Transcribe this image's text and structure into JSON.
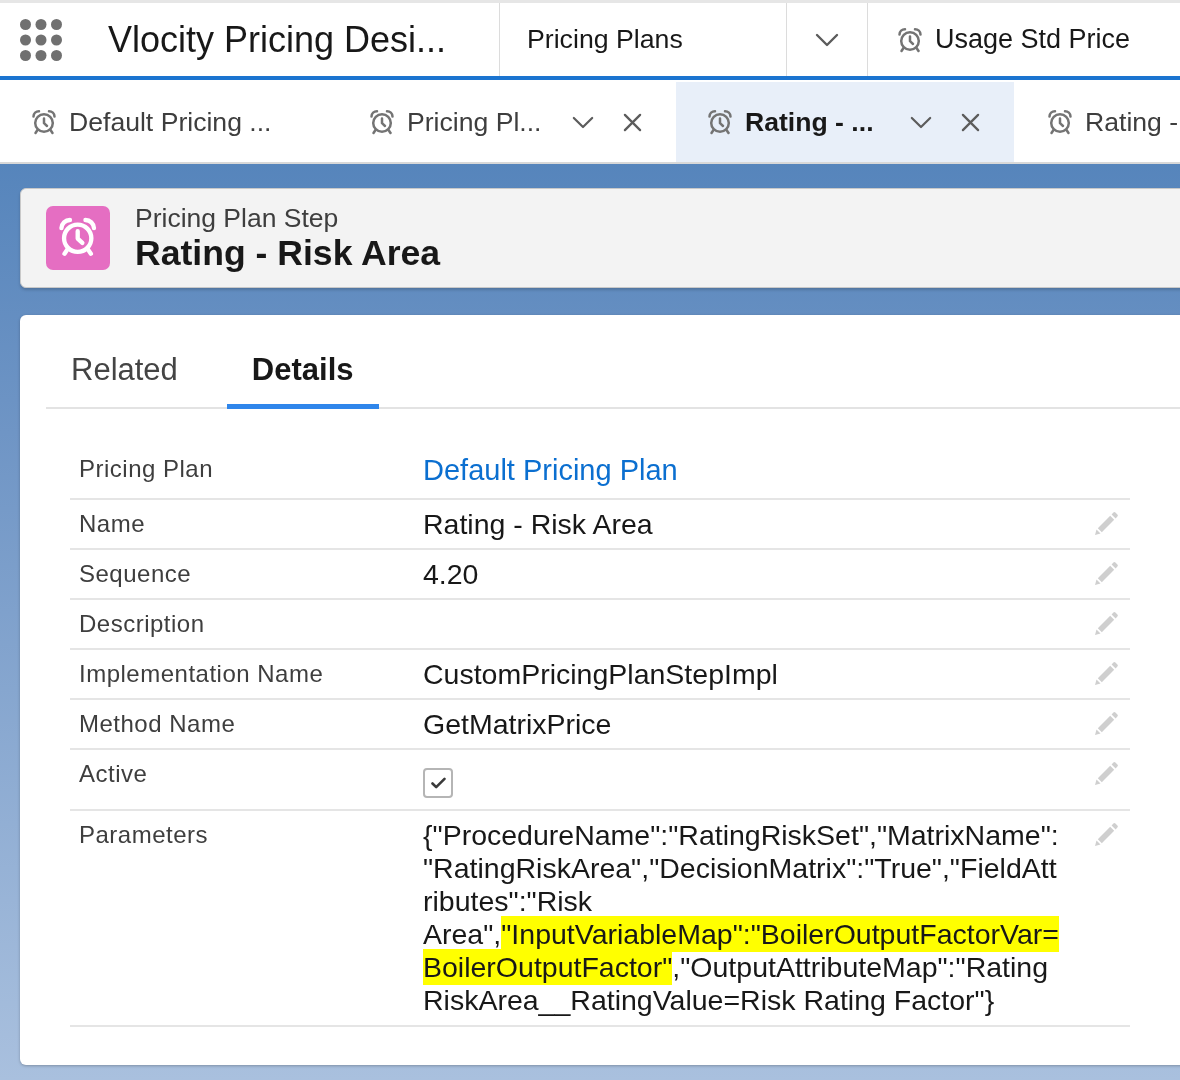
{
  "top_bar": {
    "app_name": "Vlocity Pricing Desi...",
    "navigation": {
      "label": "Pricing Plans"
    },
    "record_tab": {
      "label": "Usage Std Price"
    }
  },
  "workspace_tabs": [
    {
      "label": "Default Pricing ...",
      "selected": false,
      "actions_shown": false
    },
    {
      "label": "Pricing Pl...",
      "selected": false,
      "actions_shown": true
    },
    {
      "label": "Rating - ...",
      "selected": true,
      "actions_shown": true
    },
    {
      "label": "Rating -",
      "selected": false,
      "actions_shown": false
    }
  ],
  "record_header": {
    "object_type": "Pricing Plan Step",
    "title": "Rating - Risk Area"
  },
  "record_tabs": [
    {
      "label": "Related",
      "selected": false
    },
    {
      "label": "Details",
      "selected": true
    }
  ],
  "fields": [
    {
      "label": "Pricing Plan",
      "kind": "link",
      "value": "Default Pricing Plan",
      "editable": false
    },
    {
      "label": "Name",
      "kind": "text",
      "value": "Rating - Risk Area",
      "editable": true
    },
    {
      "label": "Sequence",
      "kind": "text",
      "value": "4.20",
      "editable": true
    },
    {
      "label": "Description",
      "kind": "text",
      "editable": true
    },
    {
      "label": "Implementation Name",
      "kind": "text",
      "value": "CustomPricingPlanStepImpl",
      "editable": true
    },
    {
      "label": "Method Name",
      "kind": "text",
      "value": "GetMatrixPrice",
      "editable": true
    },
    {
      "label": "Active",
      "kind": "checkbox",
      "checked": true,
      "editable": true
    },
    {
      "label": "Parameters",
      "kind": "segments",
      "editable": true,
      "segments": [
        {
          "text": "{\"ProcedureName\":\"RatingRiskSet\",\"MatrixName\":\"RatingRiskArea\",\"DecisionMatrix\":\"True\",\"FieldAttributes\":\"Risk Area\",",
          "highlighted": false
        },
        {
          "text": "\"InputVariableMap\":\"BoilerOutputFactorVar=BoilerOutputFactor\"",
          "highlighted": true
        },
        {
          "text": ",\"OutputAttributeMap\":\"RatingRiskArea__RatingValue=Risk Rating Factor\"}",
          "highlighted": false
        }
      ]
    }
  ]
}
